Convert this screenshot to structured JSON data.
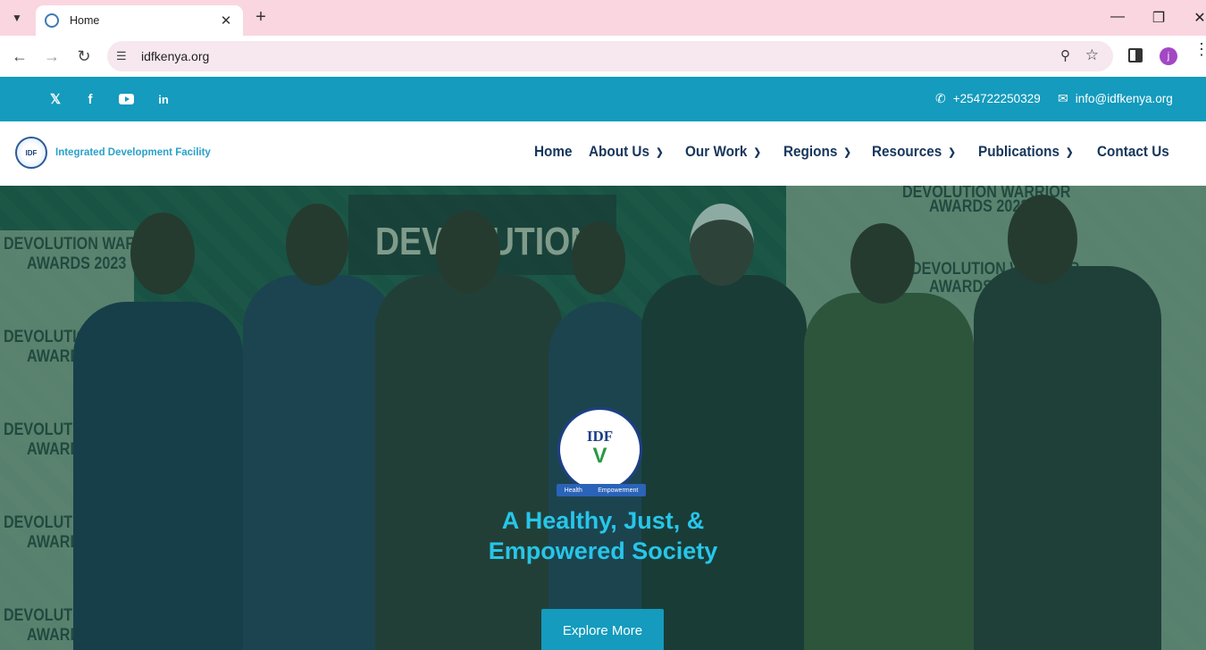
{
  "browser": {
    "tab_title": "Home",
    "url": "idfkenya.org",
    "profile_initial": "j"
  },
  "topbar": {
    "phone": "+254722250329",
    "email": "info@idfkenya.org",
    "social_icons": [
      "x-icon",
      "facebook-icon",
      "youtube-icon",
      "linkedin-icon"
    ]
  },
  "header": {
    "logo_text": "Integrated Development Facility",
    "nav": [
      {
        "label": "Home",
        "has_dropdown": false
      },
      {
        "label": "About Us",
        "has_dropdown": true
      },
      {
        "label": "Our Work",
        "has_dropdown": true
      },
      {
        "label": "Regions",
        "has_dropdown": true
      },
      {
        "label": "Resources",
        "has_dropdown": true
      },
      {
        "label": "Publications",
        "has_dropdown": true
      },
      {
        "label": "Contact Us",
        "has_dropdown": false
      }
    ]
  },
  "hero": {
    "logo_abbr": "IDF",
    "logo_ribbon_left": "Health",
    "logo_ribbon_right": "Empowerment",
    "title_line1": "A Healthy, Just, &",
    "title_line2": "Empowered Society",
    "button_label": "Explore More",
    "banner_line1": "DEVOLUTION WARRIOR",
    "banner_line2": "AWARDS 2023",
    "backdrop_word": "DEVOLUTION"
  },
  "colors": {
    "brand_teal": "#149bbd",
    "nav_text": "#17365c",
    "hero_title": "#27c6e9",
    "tab_bar": "#fad6e0"
  }
}
